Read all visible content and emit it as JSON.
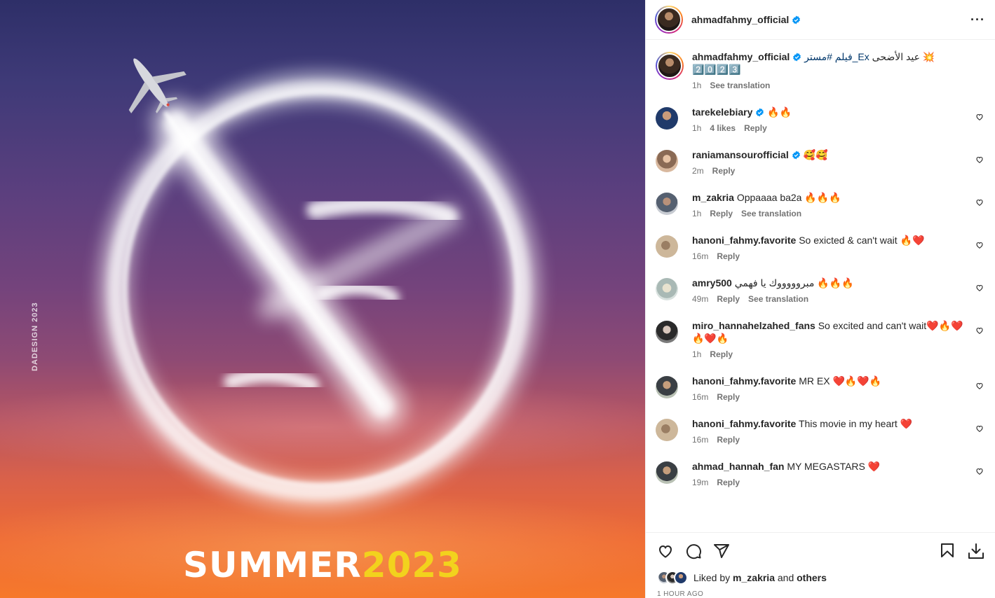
{
  "poster": {
    "title_white": "SUMMER",
    "title_yellow": "2023",
    "watermark": "DADESIGN 2023",
    "colors": {
      "white_text": "#ffffff",
      "yellow_text": "#f2d21d"
    }
  },
  "post_header": {
    "username": "ahmadfahmy_official",
    "verified": true,
    "more_icon": "more-horizontal-icon"
  },
  "caption": {
    "username": "ahmadfahmy_official",
    "text_prefix": "عيد الأضحى",
    "hashtag": "فيلم #مستر_Ex",
    "emoji": "💥",
    "line2": "2️⃣0️⃣2️⃣3️⃣",
    "time": "1h",
    "see_translation": "See translation"
  },
  "comments": [
    {
      "username": "tarekelebiary",
      "verified": true,
      "text": "🔥🔥",
      "time": "1h",
      "likes": "4 likes",
      "reply": "Reply"
    },
    {
      "username": "raniamansourofficial",
      "verified": true,
      "text": "🥰🥰",
      "time": "2m",
      "reply": "Reply"
    },
    {
      "username": "m_zakria",
      "text": "Oppaaaa ba2a 🔥🔥🔥",
      "time": "1h",
      "reply": "Reply",
      "see_translation": "See translation"
    },
    {
      "username": "hanoni_fahmy.favorite",
      "text": "So exicted & can't wait 🔥❤️",
      "time": "16m",
      "reply": "Reply"
    },
    {
      "username": "amry500",
      "text": "مبروووووك يا فهمي 🔥🔥🔥",
      "time": "49m",
      "reply": "Reply",
      "see_translation": "See translation"
    },
    {
      "username": "miro_hannahelzahed_fans",
      "text": "So excited and can't wait❤️🔥❤️🔥❤️🔥",
      "time": "1h",
      "reply": "Reply"
    },
    {
      "username": "hanoni_fahmy.favorite",
      "text": "MR EX ❤️🔥❤️🔥",
      "time": "16m",
      "reply": "Reply"
    },
    {
      "username": "hanoni_fahmy.favorite",
      "text": "This movie in my heart ❤️",
      "time": "16m",
      "reply": "Reply"
    },
    {
      "username": "ahmad_hannah_fan",
      "text": "MY MEGASTARS ❤️",
      "time": "19m",
      "reply": "Reply"
    }
  ],
  "actions": {
    "like_icon": "heart-icon",
    "comment_icon": "comment-icon",
    "share_icon": "share-icon",
    "save_icon": "bookmark-icon",
    "download_icon": "download-icon"
  },
  "likes": {
    "prefix": "Liked by",
    "user": "m_zakria",
    "and": "and",
    "others": "others"
  },
  "timestamp": "1 HOUR AGO",
  "colors": {
    "verified": "#0095f6",
    "secondary_text": "#737373",
    "hashtag": "#00376b"
  }
}
